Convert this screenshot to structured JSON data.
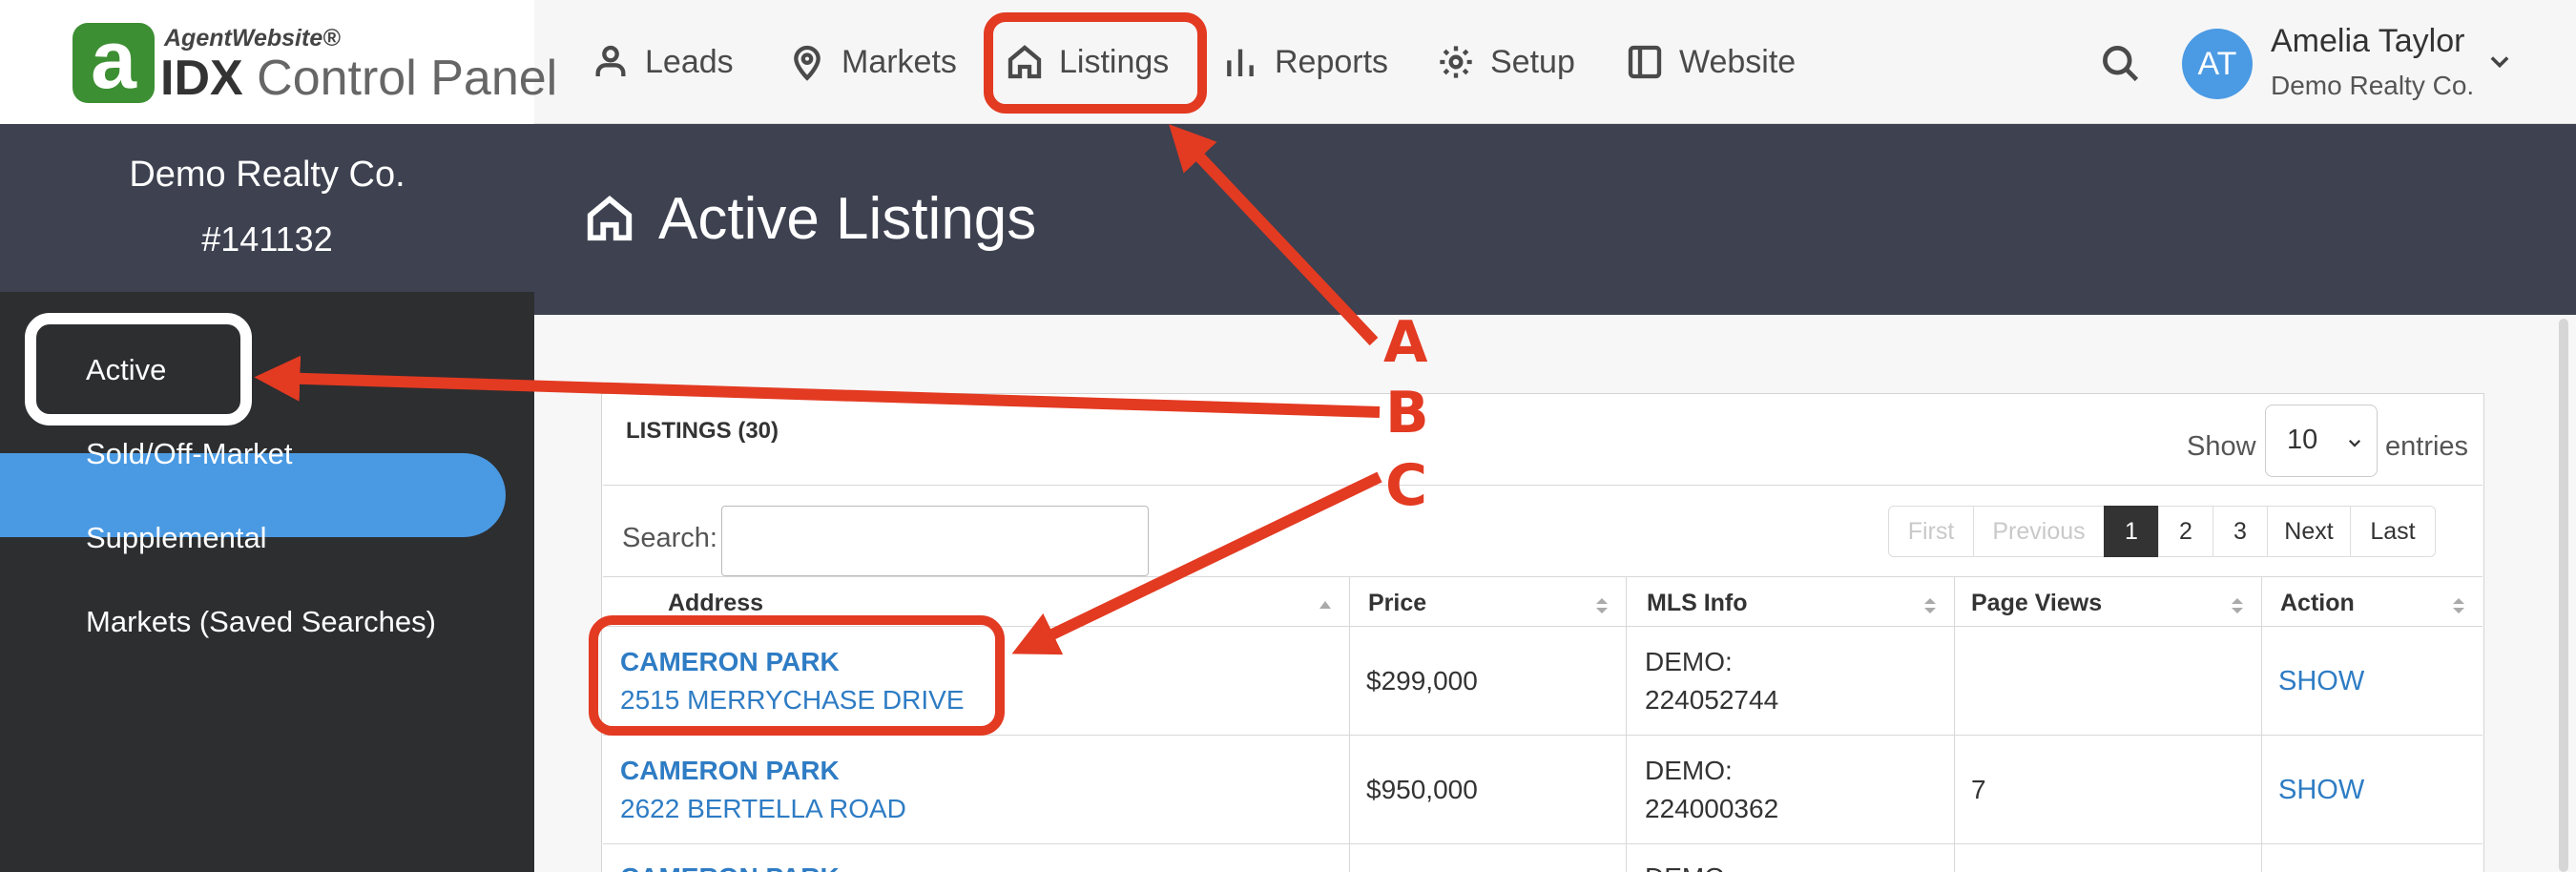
{
  "logo": {
    "badge": "a",
    "top_text": "AgentWebsite®",
    "bottom_bold": "IDX",
    "bottom_text": " Control Panel"
  },
  "nav": [
    {
      "label": "Leads",
      "icon": "user-icon"
    },
    {
      "label": "Markets",
      "icon": "map-pin-icon"
    },
    {
      "label": "Listings",
      "icon": "home-icon"
    },
    {
      "label": "Reports",
      "icon": "bar-chart-icon"
    },
    {
      "label": "Setup",
      "icon": "gear-icon"
    },
    {
      "label": "Website",
      "icon": "layout-icon"
    }
  ],
  "user": {
    "initials": "AT",
    "name": "Amelia Taylor",
    "company": "Demo Realty Co."
  },
  "sidebar": {
    "company": "Demo Realty Co.",
    "account_id": "#141132",
    "items": [
      {
        "label": "Active",
        "active": true
      },
      {
        "label": "Sold/Off-Market",
        "active": false
      },
      {
        "label": "Supplemental",
        "active": false
      },
      {
        "label": "Markets (Saved Searches)",
        "active": false
      }
    ]
  },
  "page": {
    "title": "Active Listings"
  },
  "listings": {
    "title": "LISTINGS (30)",
    "show_label": "Show",
    "entries_value": "10",
    "entries_label": "entries",
    "search_label": "Search:",
    "search_value": "",
    "pager": [
      "First",
      "Previous",
      "1",
      "2",
      "3",
      "Next",
      "Last"
    ],
    "current_page": "1",
    "columns": [
      "Address",
      "Price",
      "MLS Info",
      "Page Views",
      "Action"
    ],
    "rows": [
      {
        "city": "CAMERON PARK",
        "street": "2515 MERRYCHASE DRIVE",
        "price": "$299,000",
        "mls_1": "DEMO:",
        "mls_2": "224052744",
        "views": "",
        "action": "SHOW"
      },
      {
        "city": "CAMERON PARK",
        "street": "2622 BERTELLA ROAD",
        "price": "$950,000",
        "mls_1": "DEMO:",
        "mls_2": "224000362",
        "views": "7",
        "action": "SHOW"
      },
      {
        "city": "CAMERON PARK",
        "street": "",
        "price": "",
        "mls_1": "DEMO:",
        "mls_2": "",
        "views": "",
        "action": ""
      }
    ]
  },
  "annotations": {
    "a": "A",
    "b": "B",
    "c": "C",
    "color": "#e33a22"
  },
  "colors": {
    "accent": "#4a9ae3",
    "header_dark": "#3d4150",
    "sidebar_dark": "#2d2e30",
    "link": "#2e7cc4",
    "logo_green": "#3d8f33"
  }
}
